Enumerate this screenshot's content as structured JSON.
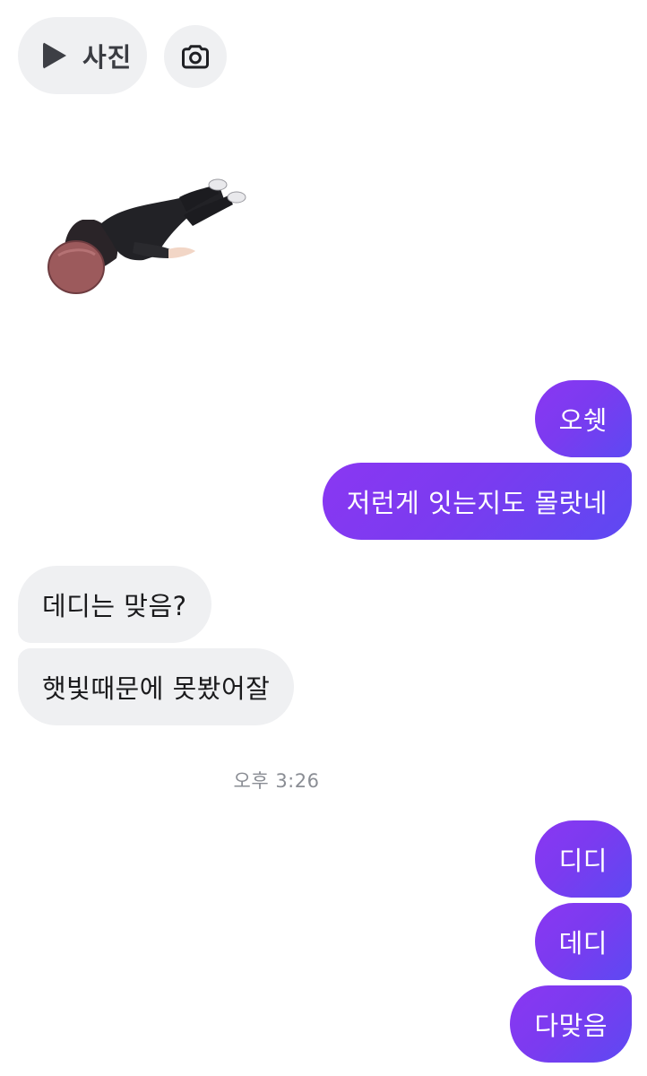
{
  "toolbar": {
    "photo_label": "사진",
    "photo_icon": "play-icon",
    "camera_icon": "camera-icon"
  },
  "sticker": {
    "icon": "lying-person-sticker"
  },
  "messages": [
    {
      "direction": "outgoing",
      "text": "오쉣"
    },
    {
      "direction": "outgoing",
      "text": "저런게 잇는지도 몰랏네"
    },
    {
      "direction": "incoming",
      "text": "데디는 맞음?"
    },
    {
      "direction": "incoming",
      "text": "햇빛때문에 못봤어잘"
    },
    {
      "direction": "outgoing",
      "text": "디디"
    },
    {
      "direction": "outgoing",
      "text": "데디"
    },
    {
      "direction": "outgoing",
      "text": "다맞음"
    }
  ],
  "timestamp": "오후 3:26",
  "colors": {
    "outgoing_bubble_start": "#8a37f2",
    "outgoing_bubble_end": "#5d49f2",
    "incoming_bubble": "#eff0f2",
    "chip_background": "#eff0f2"
  }
}
